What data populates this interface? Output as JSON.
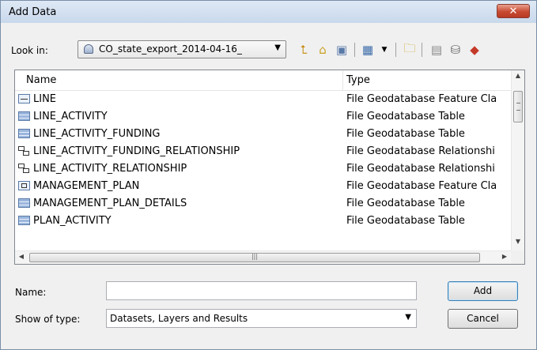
{
  "window": {
    "title": "Add Data",
    "close_glyph": "✕"
  },
  "toolbar": {
    "look_in_label": "Look in:",
    "look_in_value": "CO_state_export_2014-04-16_",
    "buttons": [
      "up-one-level-icon",
      "home-icon",
      "connect-folder-icon",
      "view-menu-icon",
      "new-folder-icon",
      "catalog-icon",
      "geodatabase-icon",
      "toolbox-icon"
    ]
  },
  "list": {
    "headers": {
      "name": "Name",
      "type": "Type"
    },
    "rows": [
      {
        "name": "LINE",
        "type": "File Geodatabase Feature Cla",
        "icon": "line-feature-class-icon"
      },
      {
        "name": "LINE_ACTIVITY",
        "type": "File Geodatabase Table",
        "icon": "table-icon"
      },
      {
        "name": "LINE_ACTIVITY_FUNDING",
        "type": "File Geodatabase Table",
        "icon": "table-icon"
      },
      {
        "name": "LINE_ACTIVITY_FUNDING_RELATIONSHIP",
        "type": "File Geodatabase Relationshi",
        "icon": "relationship-class-icon"
      },
      {
        "name": "LINE_ACTIVITY_RELATIONSHIP",
        "type": "File Geodatabase Relationshi",
        "icon": "relationship-class-icon"
      },
      {
        "name": "MANAGEMENT_PLAN",
        "type": "File Geodatabase Feature Cla",
        "icon": "polygon-feature-class-icon"
      },
      {
        "name": "MANAGEMENT_PLAN_DETAILS",
        "type": "File Geodatabase Table",
        "icon": "table-icon"
      },
      {
        "name": "PLAN_ACTIVITY",
        "type": "File Geodatabase Table",
        "icon": "table-icon"
      }
    ]
  },
  "form": {
    "name_label": "Name:",
    "name_value": "",
    "type_label": "Show of type:",
    "type_value": "Datasets, Layers and Results",
    "add_label": "Add",
    "cancel_label": "Cancel"
  }
}
